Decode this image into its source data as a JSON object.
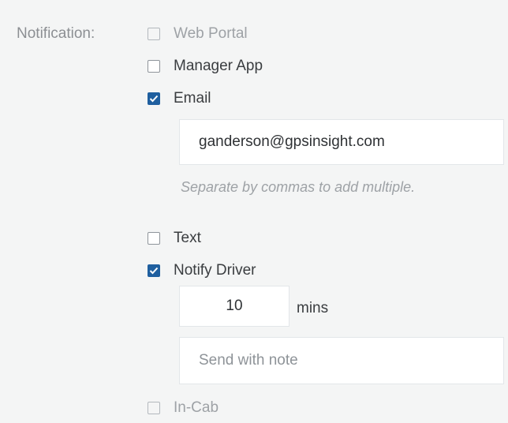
{
  "notification": {
    "label": "Notification:",
    "options": {
      "web_portal": {
        "label": "Web Portal",
        "checked": false,
        "disabled": true
      },
      "manager_app": {
        "label": "Manager App",
        "checked": false,
        "disabled": false
      },
      "email": {
        "label": "Email",
        "checked": true,
        "disabled": false
      },
      "text": {
        "label": "Text",
        "checked": false,
        "disabled": false
      },
      "notify_driver": {
        "label": "Notify Driver",
        "checked": true,
        "disabled": false
      },
      "in_cab": {
        "label": "In-Cab",
        "checked": false,
        "disabled": true
      }
    },
    "email_field": {
      "value": "ganderson@gpsinsight.com",
      "helper": "Separate by commas to add multiple."
    },
    "driver": {
      "minutes_value": "10",
      "minutes_unit": "mins",
      "note_placeholder": "Send with note"
    }
  },
  "colors": {
    "background": "#f4f5f5",
    "checkbox_checked": "#1f5f9f",
    "label_muted": "#8c8f93",
    "text": "#3a3d40"
  }
}
